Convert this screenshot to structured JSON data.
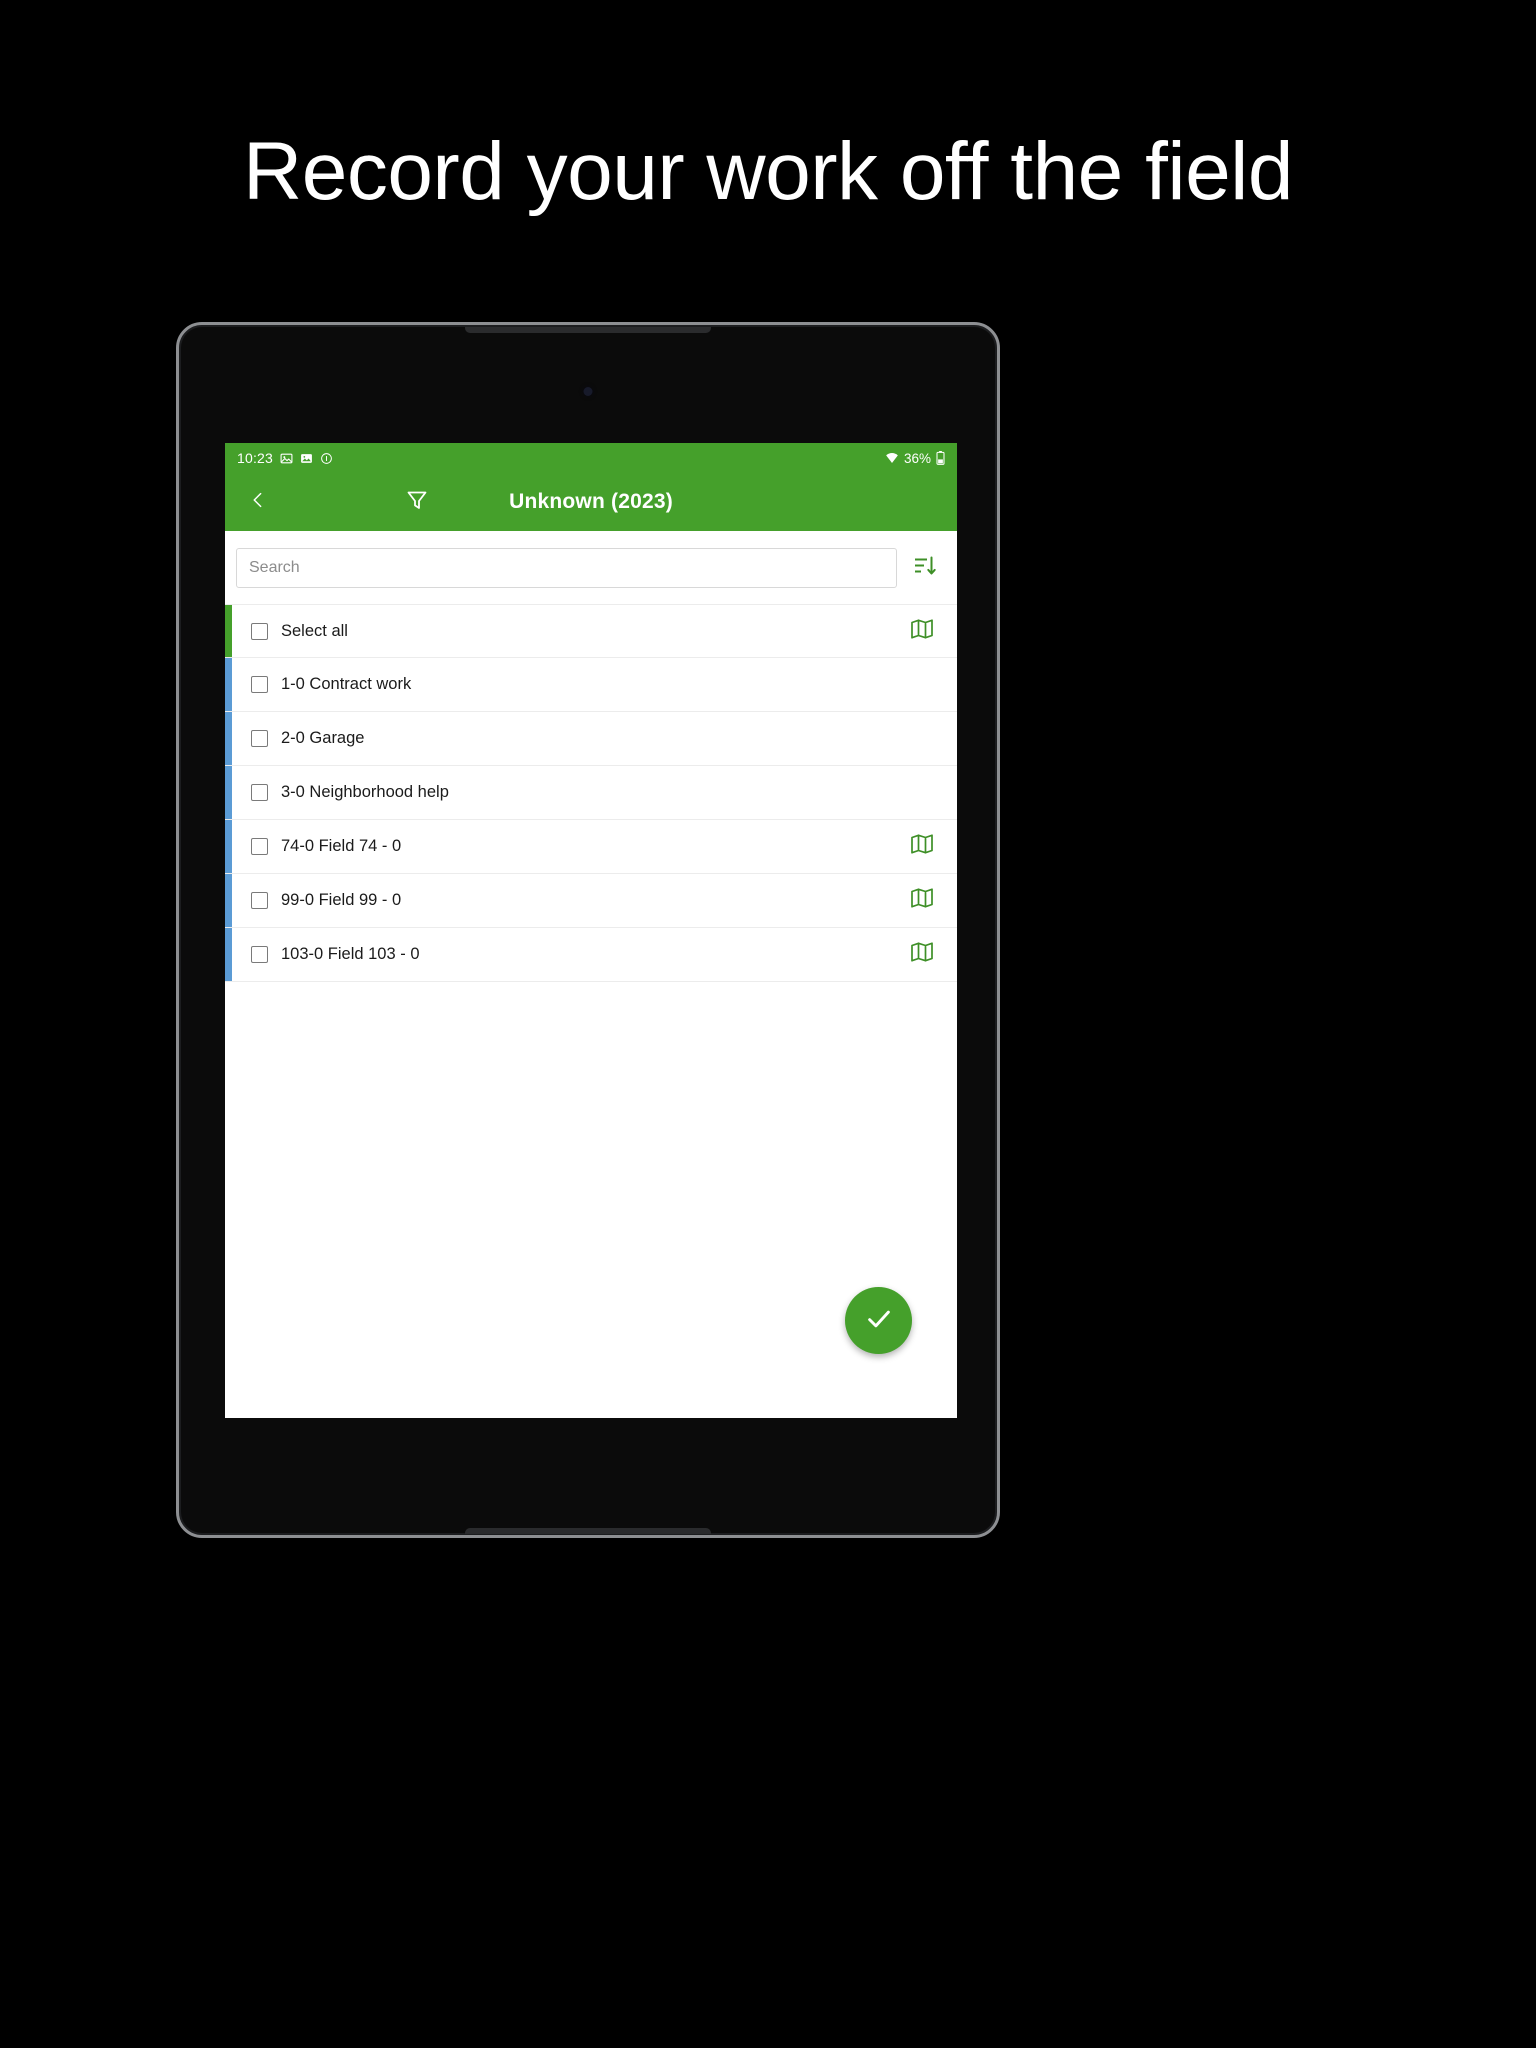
{
  "headline": {
    "text": "Record your work off the field"
  },
  "colors": {
    "brand_green": "#45a02b",
    "row_accent_green": "#45a02b",
    "row_accent_blue": "#5b9bd5",
    "page_background": "#000000",
    "screen_background": "#ffffff"
  },
  "statusbar": {
    "time": "10:23",
    "battery_percent": "36%",
    "icons": [
      "image-icon",
      "screenshot-icon",
      "info-circle-icon"
    ],
    "right_icons": [
      "wifi-icon",
      "battery-icon"
    ]
  },
  "appbar": {
    "back_label": "Back",
    "filter_label": "Filter",
    "title": "Unknown (2023)"
  },
  "search": {
    "placeholder": "Search",
    "value": "",
    "sort_label": "Sort"
  },
  "list": {
    "rows": [
      {
        "label": "Select all",
        "accent": "green",
        "has_map": true,
        "checked": false
      },
      {
        "label": "1-0 Contract work",
        "accent": "blue",
        "has_map": false,
        "checked": false
      },
      {
        "label": "2-0 Garage",
        "accent": "blue",
        "has_map": false,
        "checked": false
      },
      {
        "label": "3-0 Neighborhood help",
        "accent": "blue",
        "has_map": false,
        "checked": false
      },
      {
        "label": "74-0 Field 74 - 0",
        "accent": "blue",
        "has_map": true,
        "checked": false
      },
      {
        "label": "99-0 Field 99 - 0",
        "accent": "blue",
        "has_map": true,
        "checked": false
      },
      {
        "label": "103-0 Field 103 - 0",
        "accent": "blue",
        "has_map": true,
        "checked": false
      }
    ]
  },
  "fab": {
    "label": "Confirm",
    "icon": "check-icon"
  }
}
